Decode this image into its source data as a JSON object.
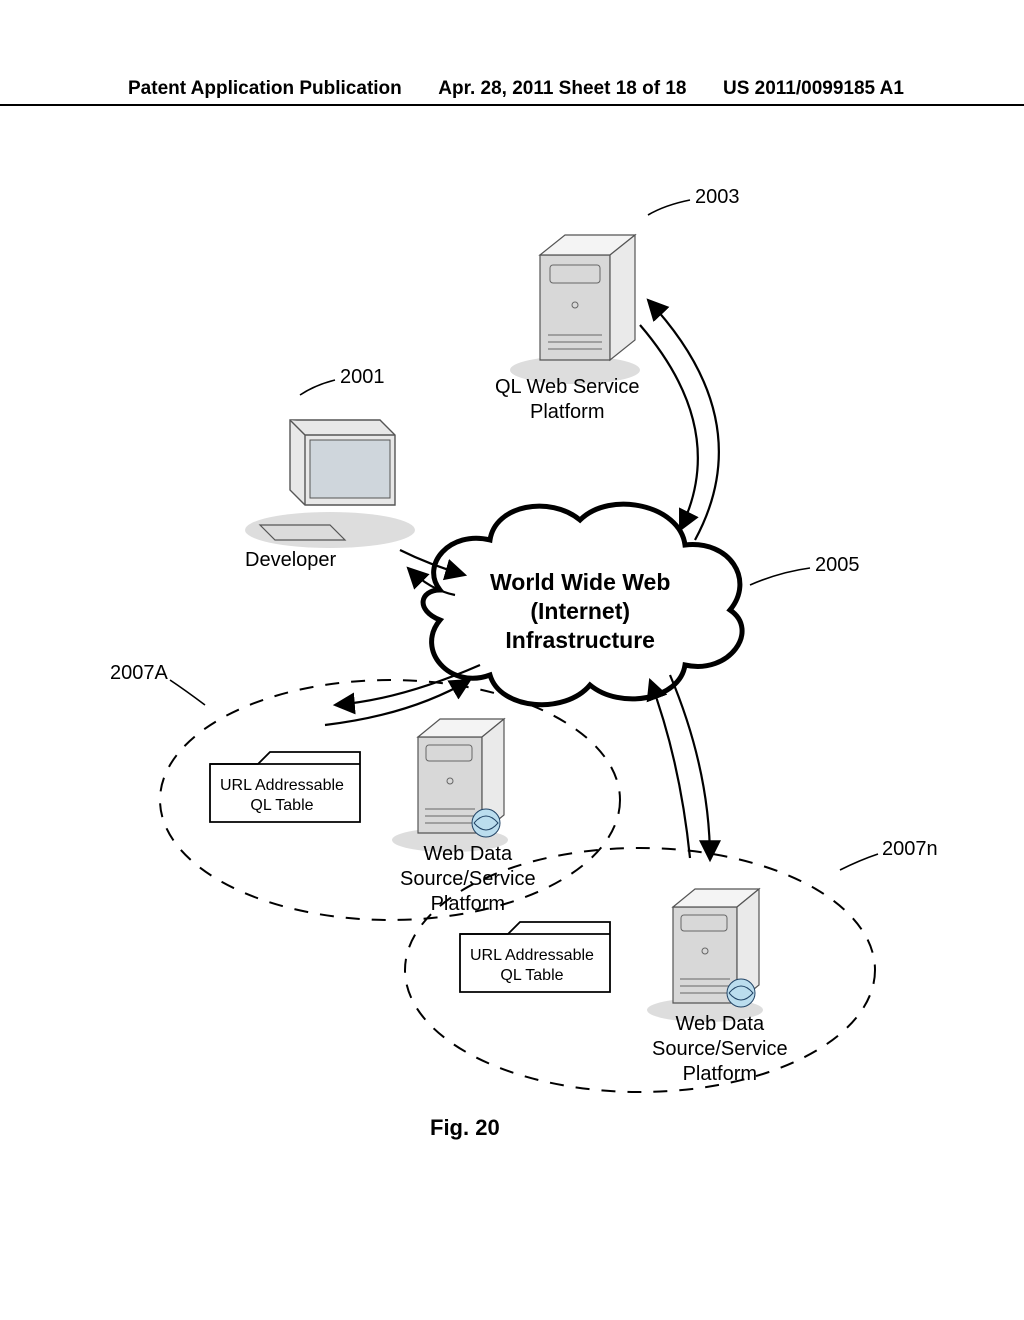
{
  "header": {
    "left": "Patent Application Publication",
    "mid": "Apr. 28, 2011  Sheet 18 of 18",
    "right": "US 2011/0099185 A1"
  },
  "refs": {
    "r2001": "2001",
    "r2003": "2003",
    "r2005": "2005",
    "r2007A": "2007A",
    "r2007n": "2007n"
  },
  "labels": {
    "developer": "Developer",
    "ql_web_service": "QL Web Service\nPlatform",
    "cloud": "World Wide Web\n(Internet)\nInfrastructure",
    "url_table": "URL Addressable\nQL Table",
    "web_data_source": "Web Data\nSource/Service\nPlatform"
  },
  "figure_title": "Fig. 20"
}
